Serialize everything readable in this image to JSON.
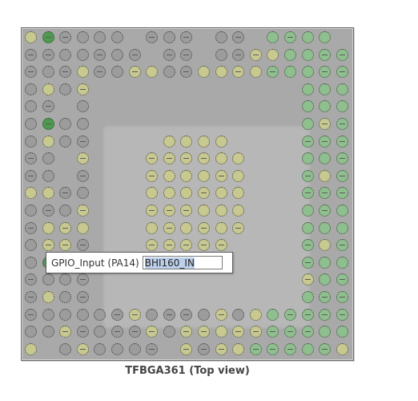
{
  "package": {
    "caption": "TFBGA361 (Top view)",
    "columns": 19,
    "rows": 19
  },
  "popup": {
    "label": "GPIO_Input (PA14)",
    "value": "BHI160_IN"
  },
  "colors": {
    "gray": "#9c9c9c",
    "yellow": "#c8c991",
    "green": "#8fbf8f",
    "dark_green": "#4e9a4e",
    "frame_bg": "#a9a9a9"
  }
}
